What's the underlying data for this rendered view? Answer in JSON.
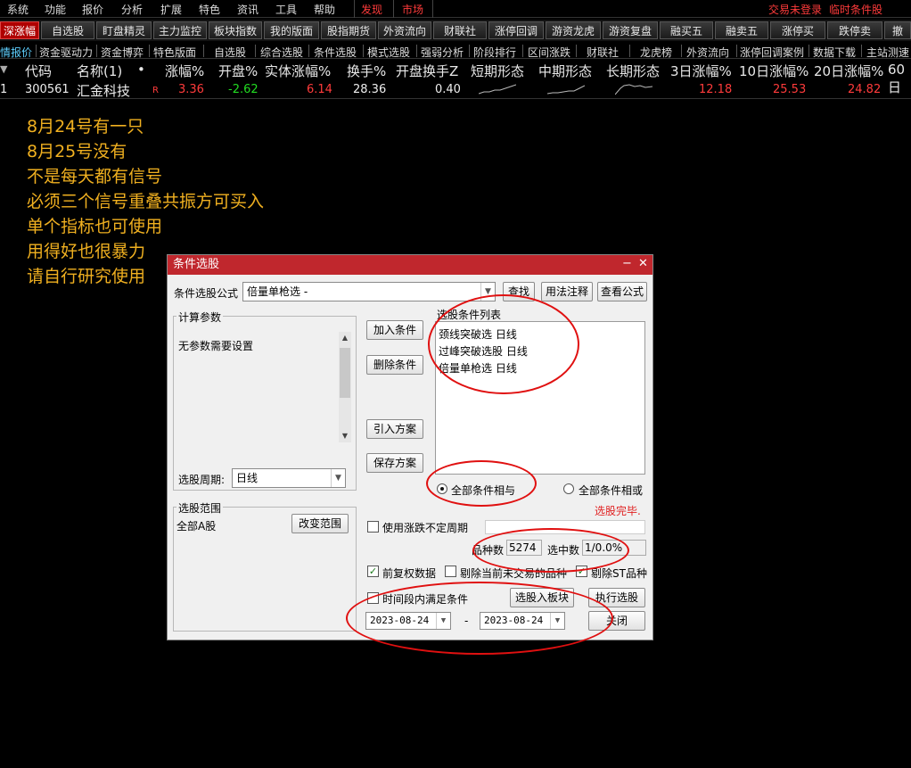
{
  "menu": {
    "items": [
      "系统",
      "功能",
      "报价",
      "分析",
      "扩展",
      "特色",
      "资讯",
      "工具",
      "帮助"
    ],
    "discover": "发现",
    "market": "市场",
    "right_status": "交易未登录",
    "right_link": "临时条件股"
  },
  "tabs1": [
    "深涨幅",
    "自选股",
    "盯盘精灵",
    "主力监控",
    "板块指数",
    "我的版面",
    "股指期货",
    "外资流向",
    "财联社",
    "涨停回调",
    "游资龙虎",
    "游资复盘",
    "融买五",
    "融卖五",
    "涨停买",
    "跌停卖",
    "撤"
  ],
  "tabs2": [
    "情报价",
    "资金驱动力",
    "资金博弈",
    "特色版面",
    "自选股",
    "综合选股",
    "条件选股",
    "模式选股",
    "强弱分析",
    "阶段排行",
    "区间涨跌",
    "财联社",
    "龙虎榜",
    "外资流向",
    "涨停回调案例",
    "数据下载",
    "主站测速"
  ],
  "table": {
    "headers": [
      "代码",
      "名称(1)",
      "•",
      "涨幅%",
      "开盘%",
      "实体涨幅%",
      "换手%",
      "开盘换手Z",
      "短期形态",
      "中期形态",
      "长期形态",
      "3日涨幅%",
      "10日涨幅%",
      "20日涨幅%",
      "60日"
    ],
    "row": {
      "index": "1",
      "code": "300561",
      "name": "汇金科技",
      "flag": "R",
      "change_pct": "3.36",
      "open_pct": "-2.62",
      "body_pct": "6.14",
      "turnover": "28.36",
      "open_turnover": "0.40",
      "d3": "12.18",
      "d10": "25.53",
      "d20": "24.82"
    }
  },
  "notes": [
    "8月24号有一只",
    "8月25号没有",
    "不是每天都有信号",
    "必须三个信号重叠共振方可买入",
    "单个指标也可使用",
    "用得好也很暴力",
    "请自行研究使用"
  ],
  "dialog": {
    "title": "条件选股",
    "formula_label": "条件选股公式",
    "formula_value": "倍量单枪选  -",
    "btn_find": "查找",
    "btn_usage": "用法注释",
    "btn_view": "查看公式",
    "params_title": "计算参数",
    "params_text": "无参数需要设置",
    "period_label": "选股周期:",
    "period_value": "日线",
    "btn_add": "加入条件",
    "btn_delete": "删除条件",
    "btn_import": "引入方案",
    "btn_save": "保存方案",
    "list_title": "选股条件列表",
    "conditions": [
      "颈线突破选 日线",
      "过峰突破选股 日线",
      "倍量单枪选 日线"
    ],
    "radio_and": "全部条件相与",
    "radio_or": "全部条件相或",
    "status": "选股完毕.",
    "range_title": "选股范围",
    "range_value": "全部A股",
    "btn_range": "改变范围",
    "chk_unfixed": "使用涨跌不定周期",
    "count_label": "品种数",
    "count_value": "5274",
    "selected_label": "选中数",
    "selected_value": "1/0.0%",
    "chk_prerights": "前复权数据",
    "chk_exclude_untraded": "剔除当前未交易的品种",
    "chk_exclude_st": "剔除ST品种",
    "chk_timerange": "时间段内满足条件",
    "btn_to_block": "选股入板块",
    "btn_execute": "执行选股",
    "date_from": "2023-08-24",
    "date_sep": "-",
    "date_to": "2023-08-24",
    "btn_close": "关闭"
  }
}
